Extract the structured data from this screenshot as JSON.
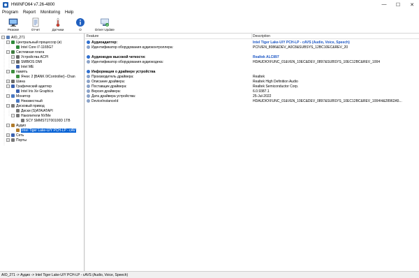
{
  "window": {
    "title": "HWiNFO64 v7.26-4800"
  },
  "window_controls": {
    "minimize": "—",
    "maximize": "☐",
    "close": "✕"
  },
  "menu": [
    "Program",
    "Report",
    "Monitoring",
    "Help"
  ],
  "toolbar": [
    {
      "label": "Резюме",
      "icon": "summary-monitor-icon"
    },
    {
      "label": "Отчет",
      "icon": "report-document-icon"
    },
    {
      "label": "Датчики",
      "icon": "sensors-thermometer-icon"
    },
    {
      "label": "О",
      "icon": "about-info-icon"
    },
    {
      "label": "Driver Update",
      "icon": "driver-update-icon"
    }
  ],
  "tree": [
    {
      "label": "AIO_271",
      "indent": 0,
      "exp": "−",
      "color": "#5a7fb8"
    },
    {
      "label": "Центральный процессор (и)",
      "indent": 1,
      "exp": "−",
      "color": "#2f8a3a"
    },
    {
      "label": "Intel Core i7-1165G7",
      "indent": 2,
      "exp": "",
      "color": "#2f8a3a"
    },
    {
      "label": "Системная плата",
      "indent": 1,
      "exp": "−",
      "color": "#3e7c3e"
    },
    {
      "label": "Устройства ACPI",
      "indent": 2,
      "exp": "+",
      "color": "#6a6a6a"
    },
    {
      "label": "SMBIOS DMI",
      "indent": 2,
      "exp": "+",
      "color": "#6a6a6a"
    },
    {
      "label": "Intel ME",
      "indent": 2,
      "exp": "",
      "color": "#3a62b0"
    },
    {
      "label": "память",
      "indent": 1,
      "exp": "−",
      "color": "#3d8e3d"
    },
    {
      "label": "Ячеи: 2 [BANK 0/Controller]--Chan",
      "indent": 2,
      "exp": "",
      "color": "#3d8e3d"
    },
    {
      "label": "Шина",
      "indent": 1,
      "exp": "+",
      "color": "#6a6a6a"
    },
    {
      "label": "Графический адаптер",
      "indent": 1,
      "exp": "−",
      "color": "#3a62b0"
    },
    {
      "label": "Intel Iris Xe Graphics",
      "indent": 2,
      "exp": "",
      "color": "#3a62b0"
    },
    {
      "label": "Монитор",
      "indent": 1,
      "exp": "−",
      "color": "#4a78c0"
    },
    {
      "label": "Неизвестный",
      "indent": 2,
      "exp": "",
      "color": "#4a78c0"
    },
    {
      "label": "Дисковый привод",
      "indent": 1,
      "exp": "−",
      "color": "#777777"
    },
    {
      "label": "Диски (S)ATA/ATAPI",
      "indent": 2,
      "exp": "",
      "color": "#777777"
    },
    {
      "label": "Накопители NVMe",
      "indent": 2,
      "exp": "−",
      "color": "#777777"
    },
    {
      "label": "SCY SMMST1T00100D 1TB",
      "indent": 3,
      "exp": "",
      "color": "#777777"
    },
    {
      "label": "Аудио",
      "indent": 1,
      "exp": "−",
      "color": "#b07a2a"
    },
    {
      "label": "Intel Tiger Lake-U/Y PCH-LP - cAV",
      "indent": 2,
      "exp": "",
      "color": "#b07a2a",
      "selected": true
    },
    {
      "label": "Сеть",
      "indent": 1,
      "exp": "+",
      "color": "#3a62b0"
    },
    {
      "label": "Порты",
      "indent": 1,
      "exp": "+",
      "color": "#777777"
    }
  ],
  "columns": {
    "feature": "Feature",
    "description": "Description"
  },
  "rows": [
    {
      "feature": "Аудиоадаптер:",
      "value": "Intel Tiger Lake-U/Y PCH-LP - cAVS (Audio, Voice, Speech)",
      "bold": true,
      "vstyle": "blue",
      "icon": "#2f6fcf"
    },
    {
      "feature": "Идентификатор оборудования аудиоконтроллера:",
      "value": "PCI\\VEN_8086&DEV_A0C8&SUBSYS_12BC10EC&REV_20",
      "bold": false,
      "vstyle": "",
      "icon": "#8aa2c8"
    },
    {
      "feature": "",
      "value": "",
      "bold": false,
      "vstyle": "",
      "icon": ""
    },
    {
      "feature": "Аудиокодек высокой четкости:",
      "value": "Realtek ALC897",
      "bold": true,
      "vstyle": "blue",
      "icon": "#2f6fcf"
    },
    {
      "feature": "Идентификатор оборудования аудиокодека:",
      "value": "HDAUDIO\\FUNC_01&VEN_10EC&DEV_0897&SUBSYS_10EC12BC&REV_1004",
      "bold": false,
      "vstyle": "",
      "icon": "#8aa2c8"
    },
    {
      "feature": "",
      "value": "",
      "bold": false,
      "vstyle": "",
      "icon": ""
    },
    {
      "feature": "Информация о драйвере устройства",
      "value": "",
      "bold": true,
      "vstyle": "",
      "icon": "#2f6fcf"
    },
    {
      "feature": "Производитель драйвера:",
      "value": "Realtek",
      "bold": false,
      "vstyle": "",
      "icon": "#8aa2c8"
    },
    {
      "feature": "Описание драйвера:",
      "value": "Realtek High Definition Audio",
      "bold": false,
      "vstyle": "",
      "icon": "#8aa2c8"
    },
    {
      "feature": "Поставщик драйвера:",
      "value": "Realtek Semiconductor Corp.",
      "bold": false,
      "vstyle": "",
      "icon": "#8aa2c8"
    },
    {
      "feature": "Версия драйвера:",
      "value": "6.0.9387.1",
      "bold": false,
      "vstyle": "",
      "icon": "#8aa2c8"
    },
    {
      "feature": "Дата драйвера устройства:",
      "value": "25-Jul-2022",
      "bold": false,
      "vstyle": "",
      "icon": "#8aa2c8"
    },
    {
      "feature": "DeviceInstanceId",
      "value": "HDAUDIO\\FUNC_01&VEN_10EC&DEV_0897&SUBSYS_10EC12BC&REV_1004\\4&28962A5...",
      "bold": false,
      "vstyle": "",
      "icon": "#8aa2c8"
    }
  ],
  "status": "AIO_271 -> Аудио -> Intel Tiger Lake-U/Y PCH-LP - cAVS (Audio, Voice, Speech)"
}
